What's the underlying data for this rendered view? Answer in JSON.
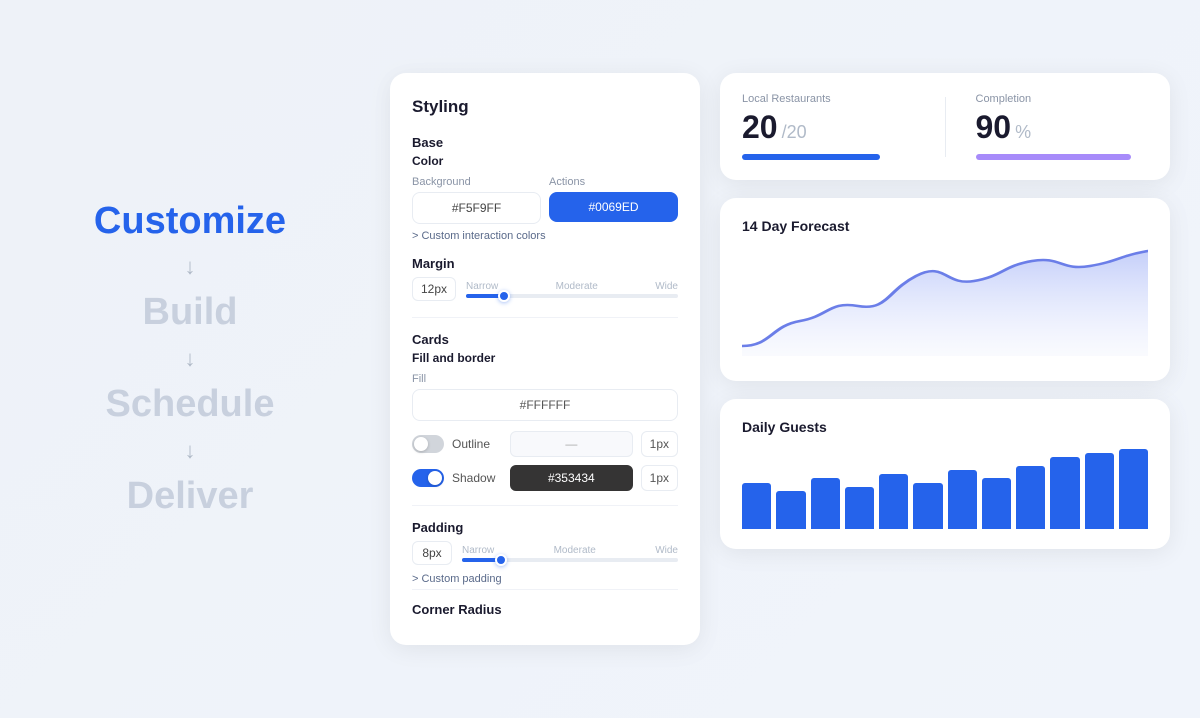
{
  "left": {
    "steps": [
      {
        "id": "customize",
        "label": "Customize",
        "active": true
      },
      {
        "id": "build",
        "label": "Build",
        "active": false
      },
      {
        "id": "schedule",
        "label": "Schedule",
        "active": false
      },
      {
        "id": "deliver",
        "label": "Deliver",
        "active": false
      }
    ],
    "arrow": "↓"
  },
  "styling": {
    "title": "Styling",
    "base_heading": "Base",
    "color_heading": "Color",
    "background_label": "Background",
    "background_value": "#F5F9FF",
    "actions_label": "Actions",
    "actions_value": "#0069ED",
    "custom_interaction_label": "> Custom interaction colors",
    "margin_heading": "Margin",
    "margin_value": "12px",
    "slider_labels": [
      "Narrow",
      "Moderate",
      "Wide"
    ],
    "margin_thumb_pct": 18,
    "cards_heading": "Cards",
    "fill_border_heading": "Fill and border",
    "fill_label": "Fill",
    "fill_value": "#FFFFFF",
    "outline_label": "Outline",
    "outline_value": "—",
    "outline_px": "1px",
    "shadow_label": "Shadow",
    "shadow_value": "#353434",
    "shadow_px": "1px",
    "padding_heading": "Padding",
    "padding_value": "8px",
    "padding_slider_labels": [
      "Narrow",
      "Moderate",
      "Wide"
    ],
    "padding_thumb_pct": 18,
    "custom_padding_label": "> Custom padding",
    "corner_radius_heading": "Corner Radius"
  },
  "stats": {
    "local_restaurants_label": "Local Restaurants",
    "local_value": "20",
    "local_suffix": "/20",
    "completion_label": "Completion",
    "completion_value": "90",
    "completion_suffix": "%"
  },
  "forecast": {
    "title": "14 Day Forecast",
    "data": [
      10,
      25,
      35,
      20,
      40,
      55,
      45,
      60,
      50,
      65,
      55,
      70,
      60,
      75
    ]
  },
  "guests": {
    "title": "Daily Guests",
    "bars": [
      55,
      45,
      60,
      50,
      65,
      55,
      70,
      60,
      75,
      85,
      90,
      95
    ]
  }
}
